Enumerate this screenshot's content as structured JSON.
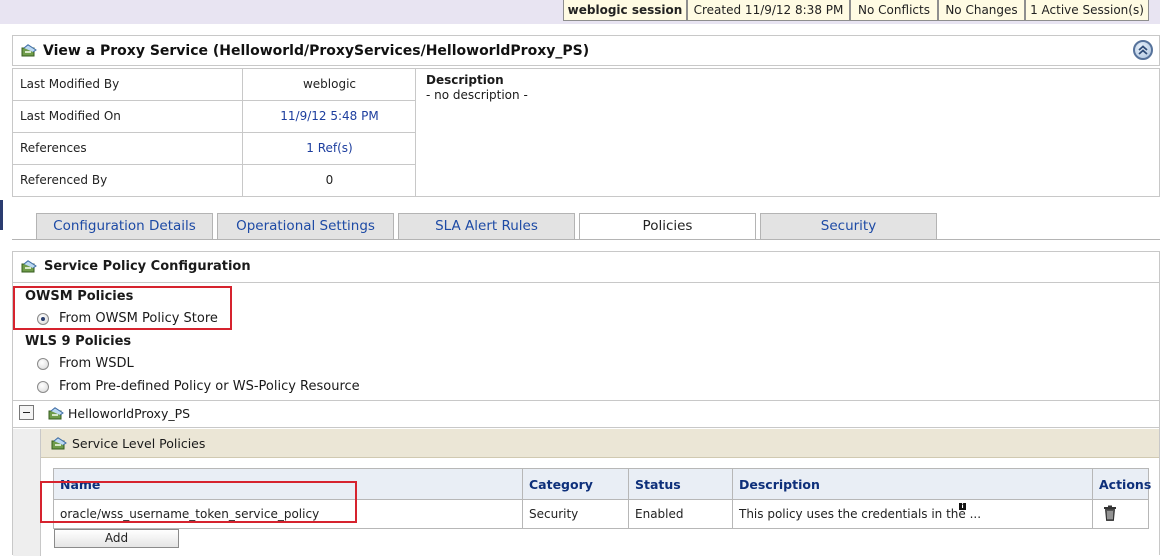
{
  "session_bar": {
    "session_name": "weblogic session",
    "created": "Created 11/9/12 8:38 PM",
    "conflicts": "No Conflicts",
    "changes": "No Changes",
    "active_sessions": "1 Active Session(s)"
  },
  "header": {
    "title": "View a Proxy Service (Helloworld/ProxyServices/HelloworldProxy_PS)"
  },
  "summary": {
    "rows": [
      {
        "label": "Last Modified By",
        "value": "weblogic"
      },
      {
        "label": "Last Modified On",
        "value": "11/9/12 5:48 PM"
      },
      {
        "label": "References",
        "value": "1 Ref(s)"
      },
      {
        "label": "Referenced By",
        "value": "0"
      }
    ],
    "description_label": "Description",
    "description_value": "- no description -"
  },
  "tabs": [
    {
      "label": "Configuration Details"
    },
    {
      "label": "Operational Settings"
    },
    {
      "label": "SLA Alert Rules"
    },
    {
      "label": "Policies"
    },
    {
      "label": "Security"
    }
  ],
  "active_tab": "Policies",
  "policy_config": {
    "title": "Service Policy Configuration",
    "owsm_title": "OWSM Policies",
    "owsm_option": "From OWSM Policy Store",
    "wls9_title": "WLS 9 Policies",
    "wls9_options": [
      "From WSDL",
      "From Pre-defined Policy or WS-Policy Resource"
    ],
    "selected_option": "From OWSM Policy Store"
  },
  "tree": {
    "service_name": "HelloworldProxy_PS",
    "section_title": "Service Level Policies"
  },
  "policies_table": {
    "headers": [
      "Name",
      "Category",
      "Status",
      "Description",
      "Actions"
    ],
    "rows": [
      {
        "name": "oracle/wss_username_token_service_policy",
        "category": "Security",
        "status": "Enabled",
        "description": "This policy uses the credentials in the ..."
      }
    ],
    "add_label": "Add"
  },
  "colors": {
    "highlight": "#d6232e",
    "link": "#1d3e9e",
    "table_header_text": "#0d2f7a"
  },
  "icons": [
    "service-icon",
    "collapse-up-icon",
    "radio-icon",
    "tree-collapse-icon",
    "info-icon",
    "trash-icon"
  ]
}
